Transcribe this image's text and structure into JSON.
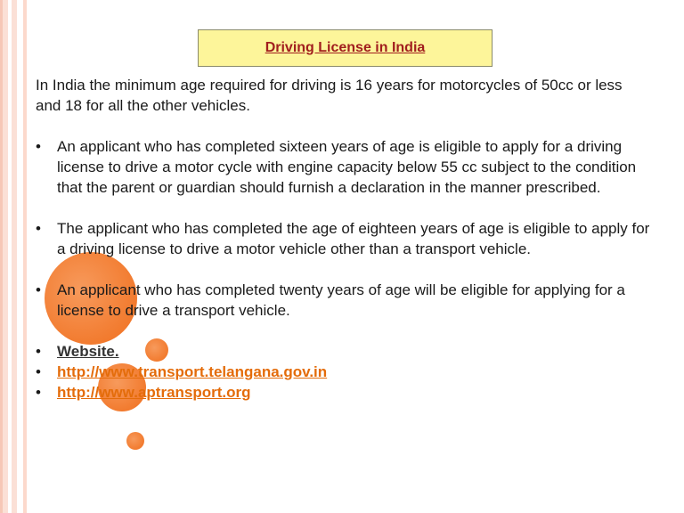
{
  "slide": {
    "title": "Driving License in India",
    "intro": "In India the minimum age required for driving is 16 years for motorcycles of 50cc or less and 18 for all the other vehicles.",
    "bullet_symbol": "•",
    "bullets": [
      "An applicant who has completed sixteen years of age is eligible to apply for a driving license to drive a motor cycle with engine capacity below 55 cc subject to the condition that the parent or guardian should furnish a declaration in the manner prescribed.",
      "The applicant who has completed the age of eighteen years of age is eligible to apply for a driving license to drive a motor vehicle other than a transport vehicle.",
      "An applicant who has completed twenty years of age will be eligible for applying for a license to drive a transport vehicle."
    ],
    "links": {
      "heading": "Website.",
      "telangana": "http://www.transport.telangana.gov.in",
      "ap": "http://www.aptransport.org"
    }
  },
  "colors": {
    "title_background": "#fdf59a",
    "title_text": "#a11e1e",
    "link_orange": "#e46c0a",
    "circle_orange": "#f27b2f",
    "band_pink": "#fbe0d6"
  }
}
